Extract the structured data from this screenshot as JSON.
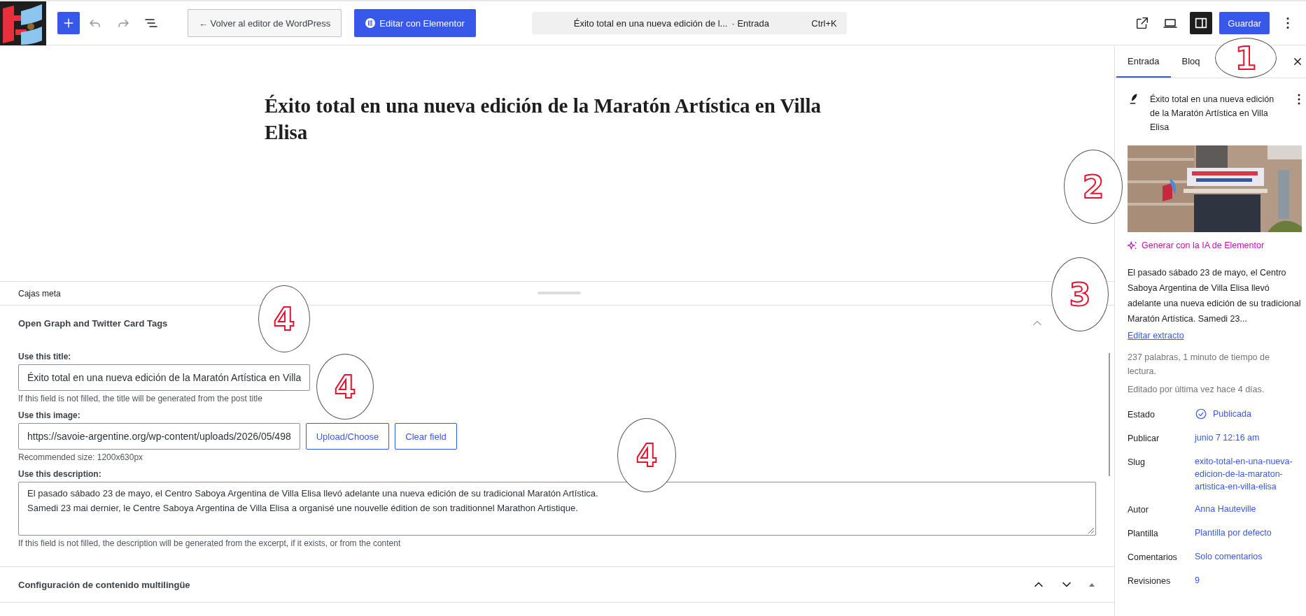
{
  "toolbar": {
    "back_button": "← Volver al editor de WordPress",
    "elementor_button": "Editar con Elementor",
    "command_bar": {
      "title": "Éxito total en una nueva edición de l...",
      "type": "· Entrada",
      "shortcut": "Ctrl+K"
    },
    "sidebar_toggle": {
      "on": true
    },
    "save_button": "Guardar"
  },
  "post_title": "Éxito total en una nueva edición de la Maratón Artística en Villa Elisa",
  "meta_boxes": {
    "title": "Cajas meta",
    "sections": [
      {
        "title": "Open Graph and Twitter Card Tags",
        "expanded": true,
        "fields": [
          {
            "kind": "input",
            "label": "Use this title:",
            "value": "Éxito total en una nueva edición de la Maratón Artística en Villa",
            "help": "If this field is not filled, the title will be generated from the post title"
          },
          {
            "label": "Use this image:",
            "value": "https://savoie-argentine.org/wp-content/uploads/2026/05/498",
            "buttons": [
              "Upload/Choose",
              "Clear field"
            ],
            "help": "Recommended size: 1200x630px"
          },
          {
            "kind": "textarea",
            "label": "Use this description:",
            "lines": [
              "El pasado sábado 23 de mayo, el Centro Saboya Argentina de Villa Elisa llevó adelante una nueva edición de su tradicional Maratón Artística.",
              "Samedi 23 mai dernier, le Centre Saboya Argentina de Villa Elisa a organisé une nouvelle édition de son traditionnel Marathon Artistique."
            ],
            "help": "If this field is not filled, the description will be generated from the excerpt, if it exists, or from the content"
          }
        ]
      },
      {
        "title": "Configuración de contenido multilingüe",
        "expanded": false
      }
    ]
  },
  "sidebar": {
    "tabs": [
      {
        "label": "Entrada",
        "selected": true
      },
      {
        "label": "Bloq",
        "selected": false
      }
    ],
    "post_summary": "Éxito total en una nueva edición de la Maratón Artística en Villa Elisa",
    "featured_image": {
      "kind": "picture"
    },
    "ai_link": "Generar con la IA de Elementor",
    "excerpt": "El pasado sábado 23 de mayo, el Centro Saboya Argentina de Villa Elisa llevó adelante una nueva edición de su tradicional Maratón Artística. Samedi 23...",
    "edit_excerpt": "Editar extracto",
    "stats": [
      "237 palabras, 1 minuto de tiempo de lectura.",
      "Editado por última vez hace 4 días."
    ],
    "rows": [
      {
        "label": "Estado",
        "value": "Publicada",
        "kind": "status"
      },
      {
        "label": "Publicar",
        "value": "junio 7 12:16 am",
        "kind": "link"
      },
      {
        "label": "Slug",
        "value": "exito-total-en-una-nueva-edicion-de-la-maraton-artistica-en-villa-elisa",
        "kind": "link"
      },
      {
        "label": "Autor",
        "value": "Anna Hauteville",
        "kind": "link"
      },
      {
        "label": "Plantilla",
        "value": "Plantilla por defecto",
        "kind": "link"
      },
      {
        "label": "Comentarios",
        "value": "Solo comentarios",
        "kind": "link"
      },
      {
        "label": "Revisiones",
        "value": "9",
        "kind": "link"
      }
    ]
  },
  "callouts": [
    "1",
    "2",
    "3",
    "4",
    "4",
    "4"
  ]
}
